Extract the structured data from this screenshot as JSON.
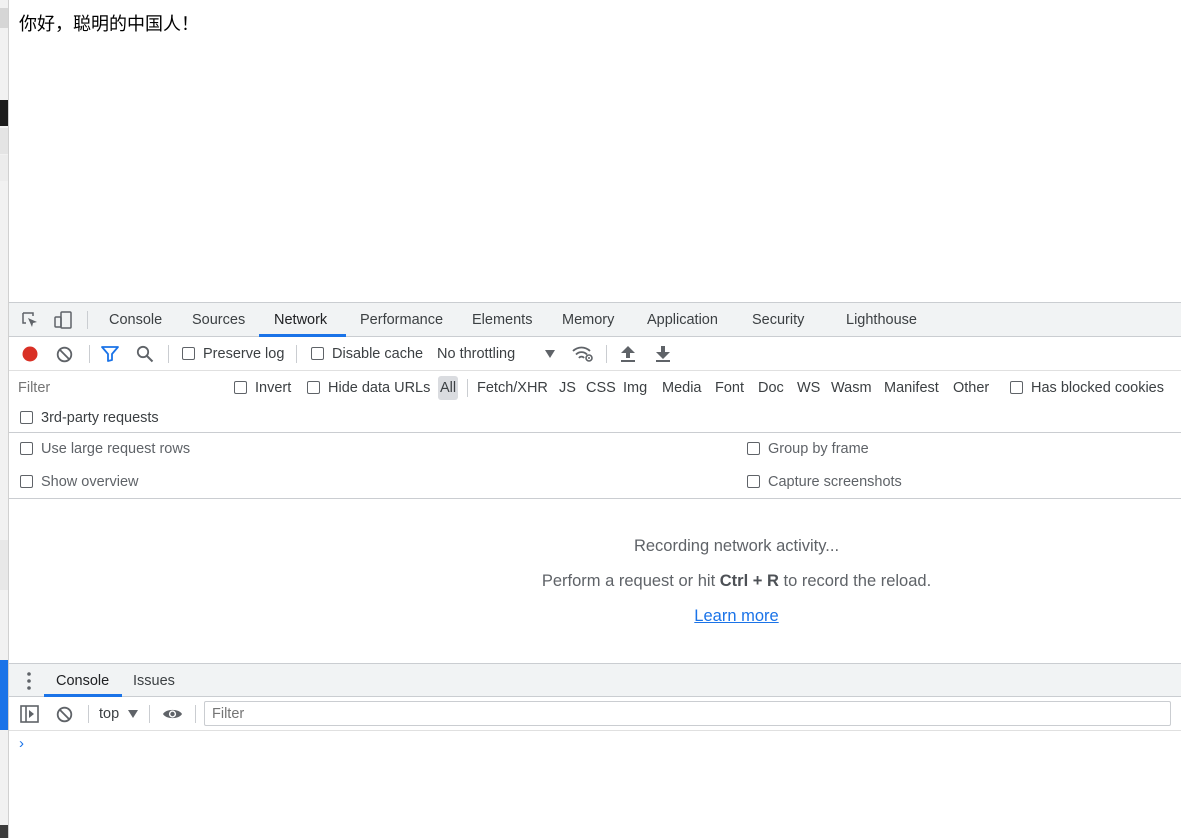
{
  "page": {
    "text": "你好，聪明的中国人！"
  },
  "devtools": {
    "tabs": [
      {
        "label": "Console"
      },
      {
        "label": "Sources"
      },
      {
        "label": "Network"
      },
      {
        "label": "Performance"
      },
      {
        "label": "Elements"
      },
      {
        "label": "Memory"
      },
      {
        "label": "Application"
      },
      {
        "label": "Security"
      },
      {
        "label": "Lighthouse"
      }
    ],
    "active_tab": "Network",
    "accent_color": "#1a73e8",
    "record_color": "#d93025"
  },
  "network_toolbar": {
    "preserve_log": "Preserve log",
    "disable_cache": "Disable cache",
    "throttling": "No throttling",
    "icons": [
      "record-icon",
      "clear-icon",
      "filter-icon",
      "search-icon",
      "network-conditions-icon",
      "import-har-icon",
      "export-har-icon"
    ]
  },
  "filter_bar": {
    "filter_placeholder": "Filter",
    "invert": "Invert",
    "hide_data_urls": "Hide data URLs",
    "types": [
      "All",
      "Fetch/XHR",
      "JS",
      "CSS",
      "Img",
      "Media",
      "Font",
      "Doc",
      "WS",
      "Wasm",
      "Manifest",
      "Other"
    ],
    "has_blocked_cookies": "Has blocked cookies",
    "third_party": "3rd-party requests"
  },
  "settings": {
    "large_rows": "Use large request rows",
    "show_overview": "Show overview",
    "group_by_frame": "Group by frame",
    "capture_screenshots": "Capture screenshots"
  },
  "empty_state": {
    "line1": "Recording network activity...",
    "line2_pre": "Perform a request or hit",
    "line2_key": "Ctrl + R",
    "line2_post": "to record the reload.",
    "learn_more": "Learn more"
  },
  "drawer": {
    "tabs": [
      {
        "label": "Console"
      },
      {
        "label": "Issues"
      }
    ],
    "context": "top",
    "filter_placeholder": "Filter",
    "prompt": "›"
  }
}
